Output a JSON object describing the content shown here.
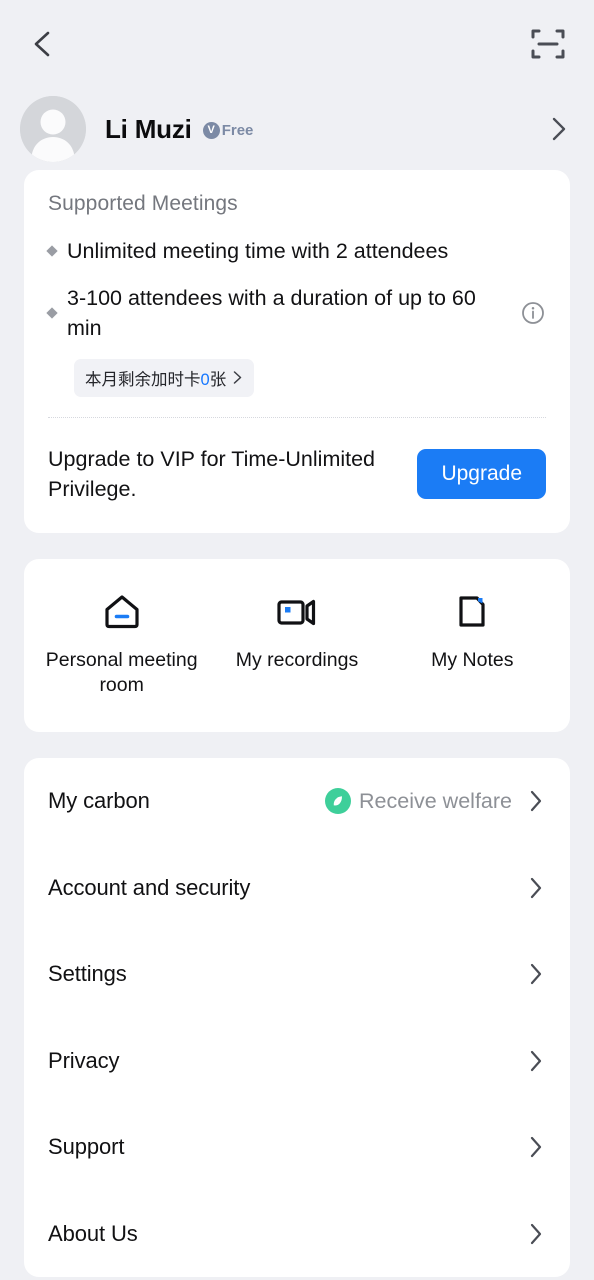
{
  "theme": {
    "page_bg": "#eff0f4",
    "card_bg": "#ffffff",
    "accent_blue": "#1b7cf5",
    "badge_gray": "#7c8aa5",
    "leaf_green": "#3ecf9a",
    "muted_text": "#74777e"
  },
  "topbar": {
    "back_icon": "chevron-left-icon",
    "scan_icon": "scan-frame-icon"
  },
  "profile": {
    "avatar_icon": "default-user-avatar",
    "name": "Li Muzi",
    "badge": {
      "mark": "V",
      "label": "Free"
    },
    "arrow_icon": "chevron-right-icon"
  },
  "meetings_card": {
    "title": "Supported Meetings",
    "bullets": [
      {
        "text": "Unlimited meeting time with 2 attendees",
        "has_info": false
      },
      {
        "text": "3-100 attendees with a duration of up to 60 min",
        "has_info": true,
        "info_icon": "info-circle-icon"
      }
    ],
    "chip": {
      "prefix": "本月剩余加时卡",
      "count": "0",
      "suffix": "张",
      "arrow_icon": "chevron-right-icon"
    },
    "upgrade": {
      "copy": "Upgrade to VIP for Time-Unlimited Privilege.",
      "button_label": "Upgrade"
    }
  },
  "shortcuts": [
    {
      "label": "Personal meeting room",
      "icon": "home-meeting-room-icon"
    },
    {
      "label": "My recordings",
      "icon": "video-camera-icon"
    },
    {
      "label": "My Notes",
      "icon": "note-document-icon"
    }
  ],
  "settings_list": [
    {
      "label": "My carbon",
      "value": "Receive welfare",
      "value_icon": "leaf-circle-icon",
      "arrow_icon": "chevron-right-icon"
    },
    {
      "label": "Account and security",
      "value": "",
      "arrow_icon": "chevron-right-icon"
    },
    {
      "label": "Settings",
      "value": "",
      "arrow_icon": "chevron-right-icon"
    },
    {
      "label": "Privacy",
      "value": "",
      "arrow_icon": "chevron-right-icon"
    },
    {
      "label": "Support",
      "value": "",
      "arrow_icon": "chevron-right-icon"
    },
    {
      "label": "About Us",
      "value": "",
      "arrow_icon": "chevron-right-icon"
    }
  ]
}
